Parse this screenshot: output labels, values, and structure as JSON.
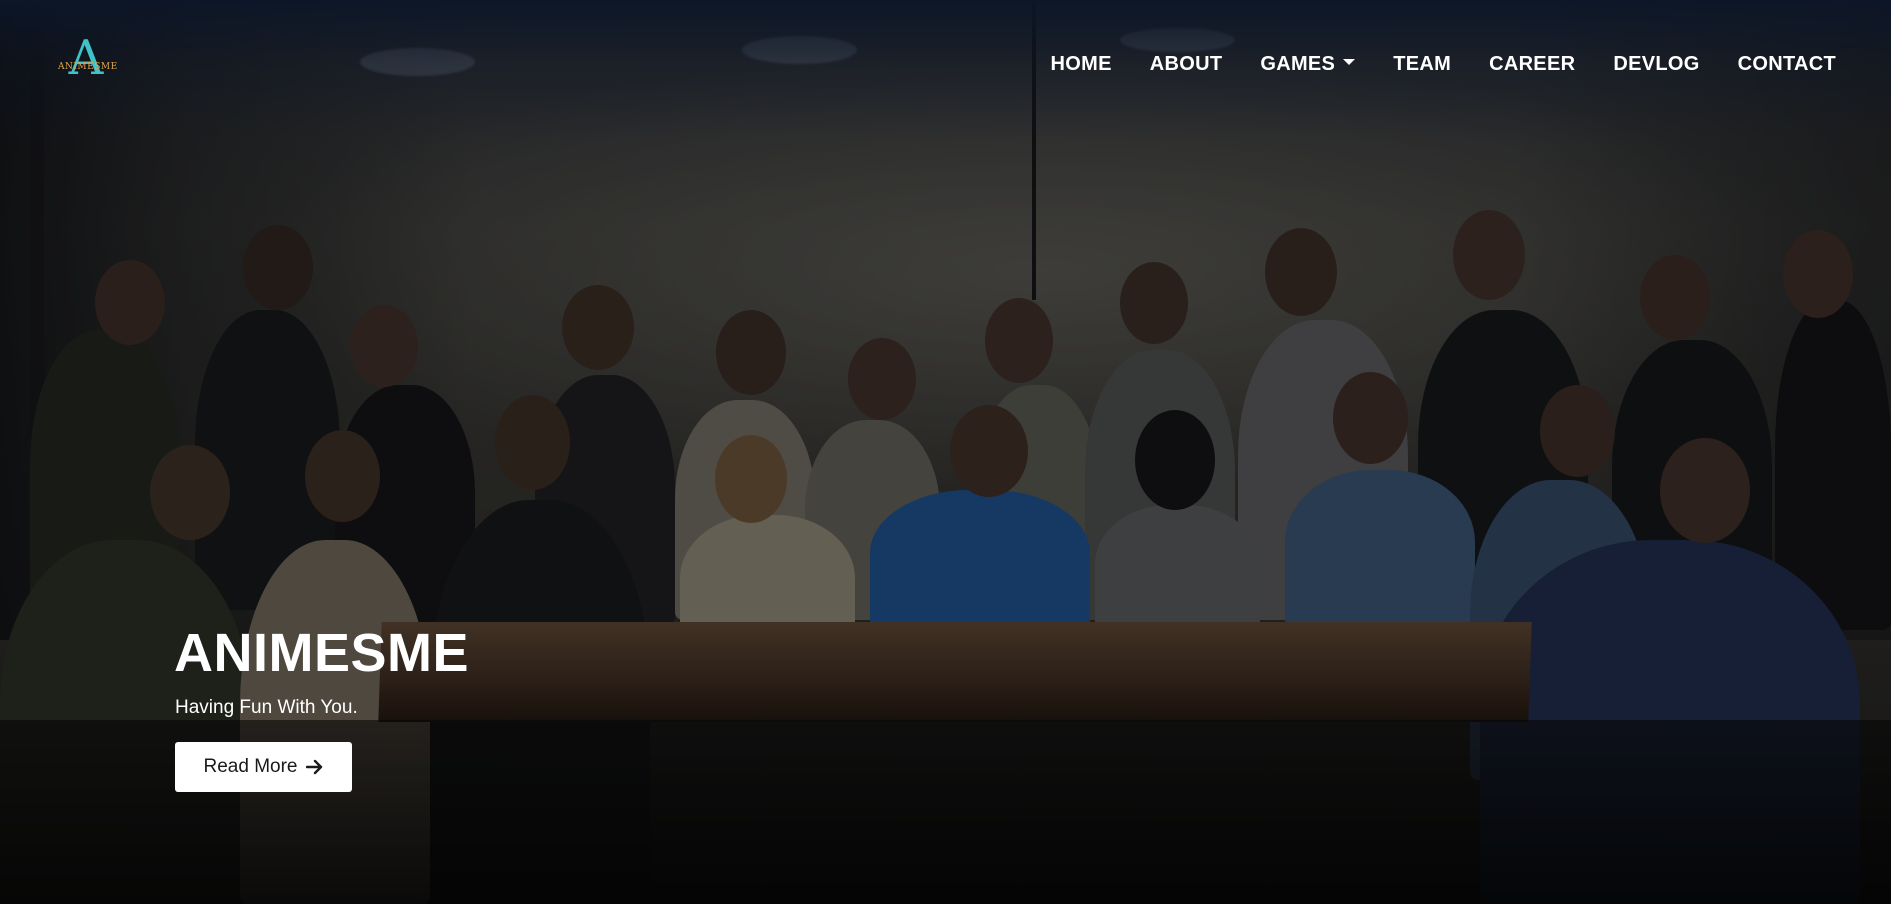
{
  "nav": {
    "logo_letter": "A",
    "logo_text": "ANIMESME",
    "items": [
      {
        "label": "HOME"
      },
      {
        "label": "ABOUT"
      },
      {
        "label": "GAMES",
        "icon": "caret-down-icon"
      },
      {
        "label": "TEAM"
      },
      {
        "label": "CAREER"
      },
      {
        "label": "DEVLOG"
      },
      {
        "label": "CONTACT"
      }
    ]
  },
  "hero": {
    "title": "ANIMESME",
    "subtitle": "Having Fun With You.",
    "button_label": "Read More",
    "button_icon": "arrow-right-icon",
    "background": "team-group-photo"
  },
  "colors": {
    "logo_teal": "#3fc3c9",
    "logo_gold": "#e3a54a",
    "nav_text": "#ffffff",
    "button_bg": "#ffffff"
  }
}
